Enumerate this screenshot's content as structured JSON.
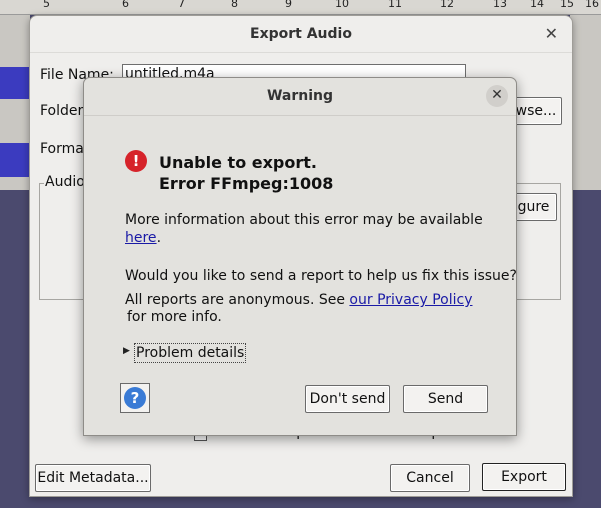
{
  "ruler": {
    "ticks": [
      "5",
      "6",
      "7",
      "8",
      "9",
      "10",
      "11",
      "12",
      "13",
      "14",
      "15",
      "16"
    ]
  },
  "export_dialog": {
    "title": "Export Audio",
    "file_name_label": "File Name:",
    "file_name_value": "untitled.m4a",
    "folder_label": "Folder",
    "browse_label": "wse...",
    "format_label": "Forma",
    "audio_group_label": "Audio",
    "configure_label": "gure",
    "trim_label": "Trim blank space before first clip",
    "edit_metadata_label": "Edit Metadata...",
    "cancel_label": "Cancel",
    "export_label": "Export"
  },
  "warning_dialog": {
    "title": "Warning",
    "heading_line1": "Unable to export.",
    "heading_line2": "Error FFmpeg:1008",
    "info_line": "More information about this error may be available",
    "info_link": "here",
    "info_link_suffix": ".",
    "report_question": "Would you like to send a report to help us fix this issue?",
    "anon_text": "All reports are anonymous. See ",
    "privacy_link": "our Privacy Policy",
    "more_info": "for more info.",
    "problem_details": "Problem details",
    "dont_send_label": "Don't send",
    "send_label": "Send"
  },
  "colors": {
    "error_icon": "#d6232a",
    "link": "#1a1aa6",
    "help_icon": "#3a7bd5",
    "background": "#4b4a6e"
  }
}
